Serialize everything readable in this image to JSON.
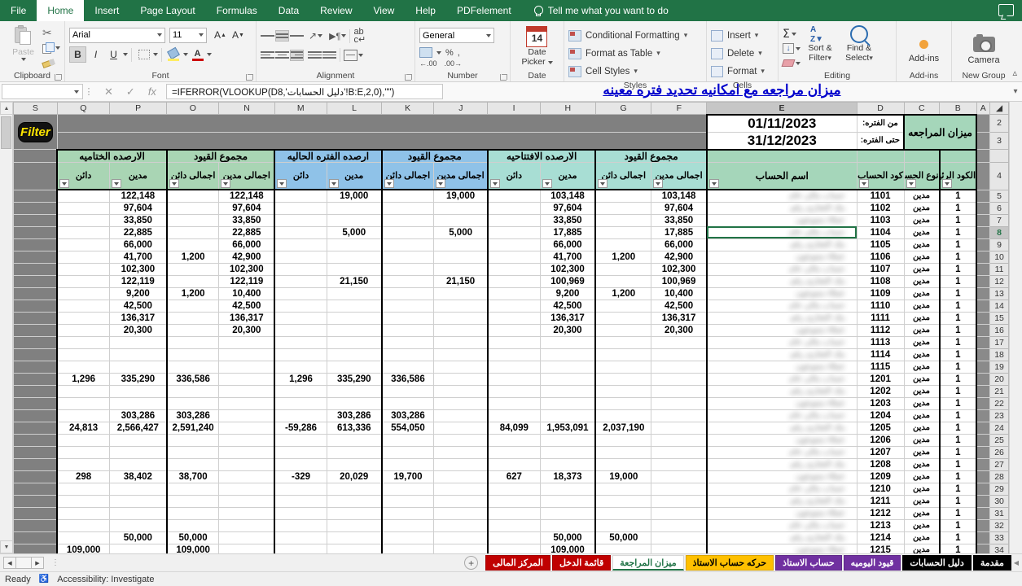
{
  "ribbon": {
    "tabs": [
      {
        "label": "File",
        "active": false
      },
      {
        "label": "Home",
        "active": true
      },
      {
        "label": "Insert",
        "active": false
      },
      {
        "label": "Page Layout",
        "active": false
      },
      {
        "label": "Formulas",
        "active": false
      },
      {
        "label": "Data",
        "active": false
      },
      {
        "label": "Review",
        "active": false
      },
      {
        "label": "View",
        "active": false
      },
      {
        "label": "Help",
        "active": false
      },
      {
        "label": "PDFelement",
        "active": false
      }
    ],
    "tell_me": "Tell me what you want to do",
    "groups": {
      "clipboard": {
        "name": "Clipboard",
        "paste": "Paste"
      },
      "font": {
        "name": "Font",
        "font_family": "Arial",
        "font_size": "11",
        "bold": "B",
        "italic": "I",
        "underline": "U",
        "grow": "A",
        "shrink": "A"
      },
      "alignment": {
        "name": "Alignment"
      },
      "number": {
        "name": "Number",
        "format": "General",
        "percent": "%",
        "comma": ","
      },
      "date": {
        "name": "Date",
        "picker_line1": "Date",
        "picker_line2": "Picker",
        "day": "14"
      },
      "styles": {
        "name": "Styles",
        "conditional_formatting": "Conditional Formatting",
        "format_as_table": "Format as Table",
        "cell_styles": "Cell Styles"
      },
      "cells": {
        "name": "Cells",
        "insert": "Insert",
        "delete": "Delete",
        "format": "Format"
      },
      "editing": {
        "name": "Editing",
        "sort_filter_1": "Sort &",
        "sort_filter_2": "Filter",
        "find_select_1": "Find &",
        "find_select_2": "Select"
      },
      "addins": {
        "name": "Add-ins",
        "label": "Add-ins"
      },
      "newgroup": {
        "name": "New Group",
        "camera": "Camera"
      }
    }
  },
  "formula_bar": {
    "name_box": "",
    "formula": "=IFERROR(VLOOKUP(D8,'دليل الحسابات'!B:E,2,0),\"\")",
    "cancel": "✕",
    "enter": "✓",
    "fx": "fx",
    "sheet_title": "ميزان مراجعه مع امكانيه تحديد فتره معينه"
  },
  "sheet": {
    "column_letters": [
      "S",
      "Q",
      "P",
      "O",
      "N",
      "M",
      "L",
      "K",
      "J",
      "I",
      "H",
      "G",
      "F",
      "E",
      "D",
      "C",
      "B",
      "A"
    ],
    "selected_column": "E",
    "row_numbers": [
      "2",
      "3",
      "4",
      "5",
      "6",
      "7",
      "8",
      "9",
      "10",
      "11",
      "12",
      "13",
      "14",
      "15",
      "16",
      "17",
      "18",
      "19",
      "20",
      "21",
      "22",
      "23",
      "24",
      "25",
      "26",
      "27",
      "28",
      "29",
      "30",
      "31",
      "32",
      "33",
      "34"
    ],
    "selected_row": "8",
    "filter_button": "Filter",
    "report_title": "ميزان المراجعه",
    "period": {
      "from_label": "من الفتره:",
      "from_value": "01/11/2023",
      "to_label": "حتى الفتره:",
      "to_value": "31/12/2023"
    },
    "group_headers": [
      {
        "label": "الارصده الختاميه",
        "color": "green",
        "span": 2
      },
      {
        "label": "مجموع القيود",
        "color": "green",
        "span": 2
      },
      {
        "label": "ارصده الفتره الحاليه",
        "color": "blue",
        "span": 2
      },
      {
        "label": "مجموع القيود",
        "color": "blue",
        "span": 2
      },
      {
        "label": "الارصده الافتتاحيه",
        "color": "teal",
        "span": 2
      },
      {
        "label": "مجموع القيود",
        "color": "teal",
        "span": 2
      }
    ],
    "sub_headers": [
      "دائن",
      "مدين",
      "اجمالى دائن",
      "اجمالى مدين",
      "دائن",
      "مدين",
      "اجمالى دائن",
      "اجمالى مدين",
      "دائن",
      "مدين",
      "اجمالى دائن",
      "اجمالى مدين",
      "اسم الحساب",
      "كود الحساب",
      "نوع الحساب",
      "الكود الرئيسي"
    ],
    "rows": [
      {
        "n": "5",
        "cls_cr": "",
        "cls_dr": "122,148",
        "jt_cr": "",
        "jt_dr": "122,148",
        "cur_cr": "",
        "cur_dr": "19,000",
        "cjt_cr": "",
        "cjt_dr": "19,000",
        "op_cr": "",
        "op_dr": "103,148",
        "ojt_cr": "",
        "ojt_dr": "103,148",
        "code": "1101",
        "type": "مدين",
        "main": "1"
      },
      {
        "n": "6",
        "cls_cr": "",
        "cls_dr": "97,604",
        "jt_cr": "",
        "jt_dr": "97,604",
        "cur_cr": "",
        "cur_dr": "",
        "cjt_cr": "",
        "cjt_dr": "",
        "op_cr": "",
        "op_dr": "97,604",
        "ojt_cr": "",
        "ojt_dr": "97,604",
        "code": "1102",
        "type": "مدين",
        "main": "1"
      },
      {
        "n": "7",
        "cls_cr": "",
        "cls_dr": "33,850",
        "jt_cr": "",
        "jt_dr": "33,850",
        "cur_cr": "",
        "cur_dr": "",
        "cjt_cr": "",
        "cjt_dr": "",
        "op_cr": "",
        "op_dr": "33,850",
        "ojt_cr": "",
        "ojt_dr": "33,850",
        "code": "1103",
        "type": "مدين",
        "main": "1"
      },
      {
        "n": "8",
        "cls_cr": "",
        "cls_dr": "22,885",
        "jt_cr": "",
        "jt_dr": "22,885",
        "cur_cr": "",
        "cur_dr": "5,000",
        "cjt_cr": "",
        "cjt_dr": "5,000",
        "op_cr": "",
        "op_dr": "17,885",
        "ojt_cr": "",
        "ojt_dr": "17,885",
        "code": "1104",
        "type": "مدين",
        "main": "1"
      },
      {
        "n": "9",
        "cls_cr": "",
        "cls_dr": "66,000",
        "jt_cr": "",
        "jt_dr": "66,000",
        "cur_cr": "",
        "cur_dr": "",
        "cjt_cr": "",
        "cjt_dr": "",
        "op_cr": "",
        "op_dr": "66,000",
        "ojt_cr": "",
        "ojt_dr": "66,000",
        "code": "1105",
        "type": "مدين",
        "main": "1"
      },
      {
        "n": "10",
        "cls_cr": "",
        "cls_dr": "41,700",
        "jt_cr": "1,200",
        "jt_dr": "42,900",
        "cur_cr": "",
        "cur_dr": "",
        "cjt_cr": "",
        "cjt_dr": "",
        "op_cr": "",
        "op_dr": "41,700",
        "ojt_cr": "1,200",
        "ojt_dr": "42,900",
        "code": "1106",
        "type": "مدين",
        "main": "1"
      },
      {
        "n": "11",
        "cls_cr": "",
        "cls_dr": "102,300",
        "jt_cr": "",
        "jt_dr": "102,300",
        "cur_cr": "",
        "cur_dr": "",
        "cjt_cr": "",
        "cjt_dr": "",
        "op_cr": "",
        "op_dr": "102,300",
        "ojt_cr": "",
        "ojt_dr": "102,300",
        "code": "1107",
        "type": "مدين",
        "main": "1"
      },
      {
        "n": "12",
        "cls_cr": "",
        "cls_dr": "122,119",
        "jt_cr": "",
        "jt_dr": "122,119",
        "cur_cr": "",
        "cur_dr": "21,150",
        "cjt_cr": "",
        "cjt_dr": "21,150",
        "op_cr": "",
        "op_dr": "100,969",
        "ojt_cr": "",
        "ojt_dr": "100,969",
        "code": "1108",
        "type": "مدين",
        "main": "1"
      },
      {
        "n": "13",
        "cls_cr": "",
        "cls_dr": "9,200",
        "jt_cr": "1,200",
        "jt_dr": "10,400",
        "cur_cr": "",
        "cur_dr": "",
        "cjt_cr": "",
        "cjt_dr": "",
        "op_cr": "",
        "op_dr": "9,200",
        "ojt_cr": "1,200",
        "ojt_dr": "10,400",
        "code": "1109",
        "type": "مدين",
        "main": "1"
      },
      {
        "n": "14",
        "cls_cr": "",
        "cls_dr": "42,500",
        "jt_cr": "",
        "jt_dr": "42,500",
        "cur_cr": "",
        "cur_dr": "",
        "cjt_cr": "",
        "cjt_dr": "",
        "op_cr": "",
        "op_dr": "42,500",
        "ojt_cr": "",
        "ojt_dr": "42,500",
        "code": "1110",
        "type": "مدين",
        "main": "1"
      },
      {
        "n": "15",
        "cls_cr": "",
        "cls_dr": "136,317",
        "jt_cr": "",
        "jt_dr": "136,317",
        "cur_cr": "",
        "cur_dr": "",
        "cjt_cr": "",
        "cjt_dr": "",
        "op_cr": "",
        "op_dr": "136,317",
        "ojt_cr": "",
        "ojt_dr": "136,317",
        "code": "1111",
        "type": "مدين",
        "main": "1"
      },
      {
        "n": "16",
        "cls_cr": "",
        "cls_dr": "20,300",
        "jt_cr": "",
        "jt_dr": "20,300",
        "cur_cr": "",
        "cur_dr": "",
        "cjt_cr": "",
        "cjt_dr": "",
        "op_cr": "",
        "op_dr": "20,300",
        "ojt_cr": "",
        "ojt_dr": "20,300",
        "code": "1112",
        "type": "مدين",
        "main": "1"
      },
      {
        "n": "17",
        "cls_cr": "",
        "cls_dr": "",
        "jt_cr": "",
        "jt_dr": "",
        "cur_cr": "",
        "cur_dr": "",
        "cjt_cr": "",
        "cjt_dr": "",
        "op_cr": "",
        "op_dr": "",
        "ojt_cr": "",
        "ojt_dr": "",
        "code": "1113",
        "type": "مدين",
        "main": "1"
      },
      {
        "n": "18",
        "cls_cr": "",
        "cls_dr": "",
        "jt_cr": "",
        "jt_dr": "",
        "cur_cr": "",
        "cur_dr": "",
        "cjt_cr": "",
        "cjt_dr": "",
        "op_cr": "",
        "op_dr": "",
        "ojt_cr": "",
        "ojt_dr": "",
        "code": "1114",
        "type": "مدين",
        "main": "1"
      },
      {
        "n": "19",
        "cls_cr": "",
        "cls_dr": "",
        "jt_cr": "",
        "jt_dr": "",
        "cur_cr": "",
        "cur_dr": "",
        "cjt_cr": "",
        "cjt_dr": "",
        "op_cr": "",
        "op_dr": "",
        "ojt_cr": "",
        "ojt_dr": "",
        "code": "1115",
        "type": "مدين",
        "main": "1"
      },
      {
        "n": "20",
        "cls_cr": "1,296",
        "cls_dr": "335,290",
        "jt_cr": "336,586",
        "jt_dr": "",
        "cur_cr": "1,296",
        "cur_dr": "335,290",
        "cjt_cr": "336,586",
        "cjt_dr": "",
        "op_cr": "",
        "op_dr": "",
        "ojt_cr": "",
        "ojt_dr": "",
        "code": "1201",
        "type": "مدين",
        "main": "1"
      },
      {
        "n": "21",
        "cls_cr": "",
        "cls_dr": "",
        "jt_cr": "",
        "jt_dr": "",
        "cur_cr": "",
        "cur_dr": "",
        "cjt_cr": "",
        "cjt_dr": "",
        "op_cr": "",
        "op_dr": "",
        "ojt_cr": "",
        "ojt_dr": "",
        "code": "1202",
        "type": "مدين",
        "main": "1"
      },
      {
        "n": "22",
        "cls_cr": "",
        "cls_dr": "",
        "jt_cr": "",
        "jt_dr": "",
        "cur_cr": "",
        "cur_dr": "",
        "cjt_cr": "",
        "cjt_dr": "",
        "op_cr": "",
        "op_dr": "",
        "ojt_cr": "",
        "ojt_dr": "",
        "code": "1203",
        "type": "مدين",
        "main": "1"
      },
      {
        "n": "23",
        "cls_cr": "",
        "cls_dr": "303,286",
        "jt_cr": "303,286",
        "jt_dr": "",
        "cur_cr": "",
        "cur_dr": "303,286",
        "cjt_cr": "303,286",
        "cjt_dr": "",
        "op_cr": "",
        "op_dr": "",
        "ojt_cr": "",
        "ojt_dr": "",
        "code": "1204",
        "type": "مدين",
        "main": "1"
      },
      {
        "n": "24",
        "cls_cr": "24,813",
        "cls_dr": "2,566,427",
        "jt_cr": "2,591,240",
        "jt_dr": "",
        "cur_cr": "-59,286",
        "cur_dr": "613,336",
        "cjt_cr": "554,050",
        "cjt_dr": "",
        "op_cr": "84,099",
        "op_dr": "1,953,091",
        "ojt_cr": "2,037,190",
        "ojt_dr": "",
        "code": "1205",
        "type": "مدين",
        "main": "1"
      },
      {
        "n": "25",
        "cls_cr": "",
        "cls_dr": "",
        "jt_cr": "",
        "jt_dr": "",
        "cur_cr": "",
        "cur_dr": "",
        "cjt_cr": "",
        "cjt_dr": "",
        "op_cr": "",
        "op_dr": "",
        "ojt_cr": "",
        "ojt_dr": "",
        "code": "1206",
        "type": "مدين",
        "main": "1"
      },
      {
        "n": "26",
        "cls_cr": "",
        "cls_dr": "",
        "jt_cr": "",
        "jt_dr": "",
        "cur_cr": "",
        "cur_dr": "",
        "cjt_cr": "",
        "cjt_dr": "",
        "op_cr": "",
        "op_dr": "",
        "ojt_cr": "",
        "ojt_dr": "",
        "code": "1207",
        "type": "مدين",
        "main": "1"
      },
      {
        "n": "27",
        "cls_cr": "",
        "cls_dr": "",
        "jt_cr": "",
        "jt_dr": "",
        "cur_cr": "",
        "cur_dr": "",
        "cjt_cr": "",
        "cjt_dr": "",
        "op_cr": "",
        "op_dr": "",
        "ojt_cr": "",
        "ojt_dr": "",
        "code": "1208",
        "type": "مدين",
        "main": "1"
      },
      {
        "n": "28",
        "cls_cr": "298",
        "cls_dr": "38,402",
        "jt_cr": "38,700",
        "jt_dr": "",
        "cur_cr": "-329",
        "cur_dr": "20,029",
        "cjt_cr": "19,700",
        "cjt_dr": "",
        "op_cr": "627",
        "op_dr": "18,373",
        "ojt_cr": "19,000",
        "ojt_dr": "",
        "code": "1209",
        "type": "مدين",
        "main": "1"
      },
      {
        "n": "29",
        "cls_cr": "",
        "cls_dr": "",
        "jt_cr": "",
        "jt_dr": "",
        "cur_cr": "",
        "cur_dr": "",
        "cjt_cr": "",
        "cjt_dr": "",
        "op_cr": "",
        "op_dr": "",
        "ojt_cr": "",
        "ojt_dr": "",
        "code": "1210",
        "type": "مدين",
        "main": "1"
      },
      {
        "n": "30",
        "cls_cr": "",
        "cls_dr": "",
        "jt_cr": "",
        "jt_dr": "",
        "cur_cr": "",
        "cur_dr": "",
        "cjt_cr": "",
        "cjt_dr": "",
        "op_cr": "",
        "op_dr": "",
        "ojt_cr": "",
        "ojt_dr": "",
        "code": "1211",
        "type": "مدين",
        "main": "1"
      },
      {
        "n": "31",
        "cls_cr": "",
        "cls_dr": "",
        "jt_cr": "",
        "jt_dr": "",
        "cur_cr": "",
        "cur_dr": "",
        "cjt_cr": "",
        "cjt_dr": "",
        "op_cr": "",
        "op_dr": "",
        "ojt_cr": "",
        "ojt_dr": "",
        "code": "1212",
        "type": "مدين",
        "main": "1"
      },
      {
        "n": "32",
        "cls_cr": "",
        "cls_dr": "",
        "jt_cr": "",
        "jt_dr": "",
        "cur_cr": "",
        "cur_dr": "",
        "cjt_cr": "",
        "cjt_dr": "",
        "op_cr": "",
        "op_dr": "",
        "ojt_cr": "",
        "ojt_dr": "",
        "code": "1213",
        "type": "مدين",
        "main": "1"
      },
      {
        "n": "33",
        "cls_cr": "",
        "cls_dr": "50,000",
        "jt_cr": "50,000",
        "jt_dr": "",
        "cur_cr": "",
        "cur_dr": "",
        "cjt_cr": "",
        "cjt_dr": "",
        "op_cr": "",
        "op_dr": "50,000",
        "ojt_cr": "50,000",
        "ojt_dr": "",
        "code": "1214",
        "type": "مدين",
        "main": "1"
      },
      {
        "n": "34",
        "cls_cr": "109,000",
        "cls_dr": "",
        "jt_cr": "109,000",
        "jt_dr": "",
        "cur_cr": "",
        "cur_dr": "",
        "cjt_cr": "",
        "cjt_dr": "",
        "op_cr": "",
        "op_dr": "109,000",
        "ojt_cr": "",
        "ojt_dr": "",
        "code": "1215",
        "type": "مدين",
        "main": "1"
      }
    ]
  },
  "sheet_tabs": [
    {
      "label": "المركز المالى",
      "color": "#c00000",
      "active": false
    },
    {
      "label": "قائمة الدخل",
      "color": "#c00000",
      "active": false
    },
    {
      "label": "ميزان المراجعة",
      "color": "#ffffff",
      "active": true
    },
    {
      "label": "حركه حساب الاستاذ",
      "color": "#ffc000",
      "active": false
    },
    {
      "label": "حساب الاستاذ",
      "color": "#7030a0",
      "active": false
    },
    {
      "label": "قيود اليوميه",
      "color": "#7030a0",
      "active": false
    },
    {
      "label": "دليل الحسابات",
      "color": "#000000",
      "active": false
    },
    {
      "label": "مقدمة",
      "color": "#000000",
      "active": false
    }
  ],
  "status_bar": {
    "ready": "Ready",
    "accessibility": "Accessibility: Investigate"
  }
}
